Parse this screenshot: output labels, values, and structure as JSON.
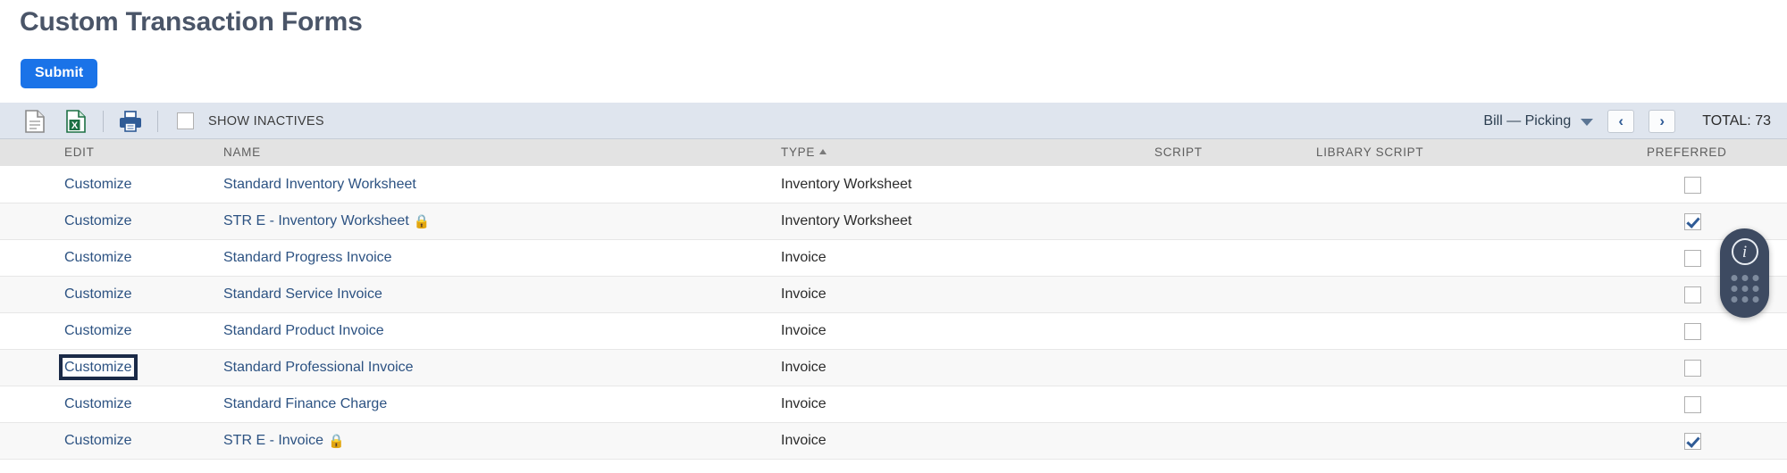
{
  "page": {
    "title": "Custom Transaction Forms"
  },
  "actions": {
    "submit_label": "Submit"
  },
  "toolbar": {
    "icons": [
      {
        "name": "new-document-icon",
        "label": ""
      },
      {
        "name": "export-excel-icon",
        "label": ""
      },
      {
        "name": "print-icon",
        "label": ""
      }
    ],
    "show_inactives_label": "SHOW INACTIVES",
    "show_inactives_checked": false,
    "form_selector_value": "Bill — Picking",
    "prev_label": "‹",
    "next_label": "›",
    "total_label": "TOTAL: 73"
  },
  "table": {
    "columns": [
      {
        "key": "edit",
        "label": "EDIT",
        "sorted": false
      },
      {
        "key": "name",
        "label": "NAME",
        "sorted": false
      },
      {
        "key": "type",
        "label": "TYPE",
        "sorted": true,
        "sort_dir": "asc"
      },
      {
        "key": "script",
        "label": "SCRIPT",
        "sorted": false
      },
      {
        "key": "library_script",
        "label": "LIBRARY SCRIPT",
        "sorted": false
      },
      {
        "key": "preferred",
        "label": "PREFERRED",
        "sorted": false
      }
    ],
    "rows": [
      {
        "edit": "Customize",
        "name": "Standard Inventory Worksheet",
        "locked": false,
        "type": "Inventory Worksheet",
        "script": "",
        "library_script": "",
        "preferred": false,
        "focused": false
      },
      {
        "edit": "Customize",
        "name": "STR E - Inventory Worksheet",
        "locked": true,
        "type": "Inventory Worksheet",
        "script": "",
        "library_script": "",
        "preferred": true,
        "focused": false
      },
      {
        "edit": "Customize",
        "name": "Standard Progress Invoice",
        "locked": false,
        "type": "Invoice",
        "script": "",
        "library_script": "",
        "preferred": false,
        "focused": false
      },
      {
        "edit": "Customize",
        "name": "Standard Service Invoice",
        "locked": false,
        "type": "Invoice",
        "script": "",
        "library_script": "",
        "preferred": false,
        "focused": false
      },
      {
        "edit": "Customize",
        "name": "Standard Product Invoice",
        "locked": false,
        "type": "Invoice",
        "script": "",
        "library_script": "",
        "preferred": false,
        "focused": false
      },
      {
        "edit": "Customize",
        "name": "Standard Professional Invoice",
        "locked": false,
        "type": "Invoice",
        "script": "",
        "library_script": "",
        "preferred": false,
        "focused": true
      },
      {
        "edit": "Customize",
        "name": "Standard Finance Charge",
        "locked": false,
        "type": "Invoice",
        "script": "",
        "library_script": "",
        "preferred": false,
        "focused": false
      },
      {
        "edit": "Customize",
        "name": "STR E - Invoice",
        "locked": true,
        "type": "Invoice",
        "script": "",
        "library_script": "",
        "preferred": true,
        "focused": false
      }
    ]
  },
  "help_widget": {
    "info_glyph": "i",
    "name": "help-launcher"
  },
  "colors": {
    "accent_blue": "#1a73e8",
    "link_blue": "#2c5282",
    "title_gray": "#4a5568",
    "toolbar_bg": "#dfe5ee",
    "header_bg": "#e3e3e3",
    "lock_gold": "#d4a72c",
    "widget_bg": "#3d4a61"
  }
}
